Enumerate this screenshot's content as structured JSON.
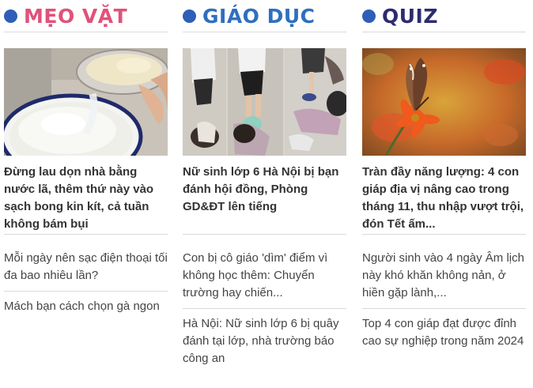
{
  "columns": [
    {
      "title": "MẸO VẶT",
      "accent": "#e0527b",
      "dot": "#2e5eb8",
      "image_subject": "rice-water-bowl-photo",
      "featured": "Đừng lau dọn nhà bằng nước lã, thêm thứ này vào sạch bong kin kít, cả tuần không bám bụi",
      "items": [
        "Mỗi ngày nên sạc điện thoại tối đa bao nhiêu lần?",
        "Mách bạn cách chọn gà ngon"
      ]
    },
    {
      "title": "GIÁO DỤC",
      "accent": "#2e6fbf",
      "dot": "#2e5eb8",
      "image_subject": "school-incident-photo-collage",
      "featured": "Nữ sinh lớp 6 Hà Nội bị bạn đánh hội đồng, Phòng GD&ĐT lên tiếng",
      "items": [
        "Con bị cô giáo 'dìm' điểm vì không học thêm: Chuyển trường hay chiến...",
        "Hà Nội: Nữ sinh lớp 6 bị quây đánh tại lớp, nhà trường báo công an"
      ]
    },
    {
      "title": "QUIZ",
      "accent": "#2c2c6e",
      "dot": "#2e5eb8",
      "image_subject": "butterfly-on-orange-flower-photo",
      "featured": "Tràn đầy năng lượng: 4 con giáp địa vị nâng cao trong tháng 11, thu nhập vượt trội, đón Tết ấm...",
      "items": [
        "Người sinh vào 4 ngày Âm lịch này khó khăn không nản, ở hiền gặp lành,...",
        "Top 4 con giáp đạt được đỉnh cao sự nghiệp trong năm 2024"
      ]
    }
  ]
}
